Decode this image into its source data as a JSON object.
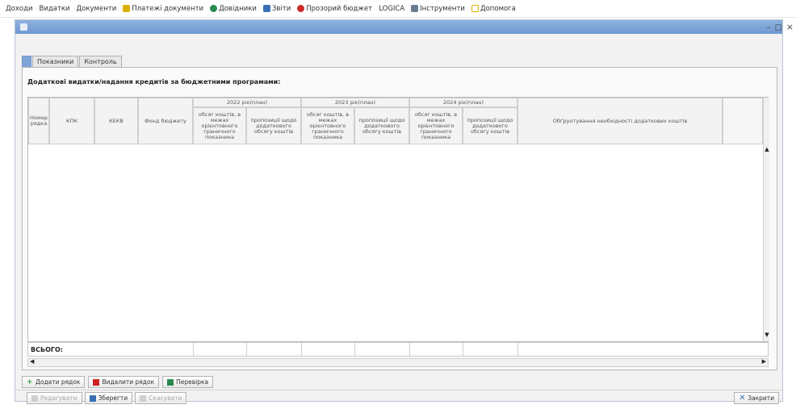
{
  "menu": {
    "items": [
      {
        "label": "Доходи",
        "icon": "none"
      },
      {
        "label": "Видатки",
        "icon": "none"
      },
      {
        "label": "Документи",
        "icon": "none"
      },
      {
        "label": "Платежі документи",
        "icon": "payment-docs-icon",
        "color": "#d9b000"
      },
      {
        "label": "Довідники",
        "icon": "directory-icon",
        "color": "#2a8a52"
      },
      {
        "label": "Звіти",
        "icon": "reports-icon",
        "color": "#3a6fb5"
      },
      {
        "label": "Прозорий бюджет",
        "icon": "budget-icon",
        "color": "#cc2a2a"
      },
      {
        "label": "LOGICA",
        "icon": "none"
      },
      {
        "label": "Інструменти",
        "icon": "tools-icon",
        "color": "#6a7d8f"
      },
      {
        "label": "Допомога",
        "icon": "help-icon",
        "color": "#d9b000"
      }
    ]
  },
  "window": {
    "title": "",
    "controls": [
      "–",
      "◻",
      "×"
    ]
  },
  "tabs": [
    {
      "label": "",
      "active": true
    },
    {
      "label": "Показники",
      "active": false
    },
    {
      "label": "Контроль",
      "active": false
    }
  ],
  "section": {
    "title": "Додаткові видатки/надання кредитів за бюджетними програмами:"
  },
  "table": {
    "columns": {
      "row_number": "Номер рядка",
      "kpk": "КПК",
      "kekv": "КЕКВ",
      "fund": "Фонд бюджету",
      "justification": "Обґрунтування необхідності додаткових коштів"
    },
    "year_groups": [
      {
        "year": "2022 рік(план)",
        "sub": [
          "обсяг коштів, в межах орієнтовного граничного показника",
          "пропозиції щодо додаткового обсягу коштів"
        ]
      },
      {
        "year": "2023 рік(план)",
        "sub": [
          "обсяг коштів, в межах орієнтовного граничного показника",
          "пропозиції щодо додаткового обсягу коштів"
        ]
      },
      {
        "year": "2024 рік(план)",
        "sub": [
          "обсяг коштів, в межах орієнтовного граничного показника",
          "пропозиції щодо додаткового обсягу коштів"
        ]
      }
    ],
    "total_label": "ВСЬОГО:",
    "rows": []
  },
  "row_buttons": [
    {
      "label": "Додати рядок",
      "icon": "add-row-icon",
      "color": "#2e9a3a"
    },
    {
      "label": "Видалити рядок",
      "icon": "delete-row-icon",
      "color": "#cc2222"
    },
    {
      "label": "Перевірка",
      "icon": "check-icon",
      "color": "#2a8a52"
    }
  ],
  "footer": {
    "left_buttons": [
      {
        "label": "Редагувати",
        "icon": "edit-icon",
        "enabled": false
      },
      {
        "label": "Зберегти",
        "icon": "save-icon",
        "enabled": true
      },
      {
        "label": "Скасувати",
        "icon": "cancel-icon",
        "enabled": false
      }
    ],
    "close": {
      "label": "Закрити",
      "icon": "close-icon",
      "color": "#3a6fb5"
    }
  }
}
